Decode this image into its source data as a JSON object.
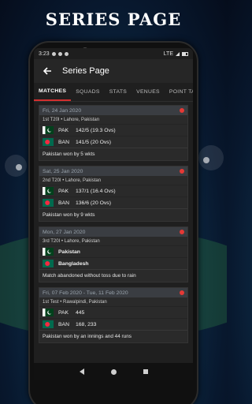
{
  "headline": "SERIES PAGE",
  "status_bar": {
    "time": "3:23",
    "network": "LTE"
  },
  "app_bar": {
    "title": "Series Page"
  },
  "tabs": [
    {
      "label": "MATCHES",
      "active": true
    },
    {
      "label": "SQUADS",
      "active": false
    },
    {
      "label": "STATS",
      "active": false
    },
    {
      "label": "VENUES",
      "active": false
    },
    {
      "label": "POINT TA",
      "active": false
    }
  ],
  "matches": [
    {
      "date": "Fri, 24 Jan 2020",
      "venue": "1st T20I • Lahore, Pakistan",
      "teams": [
        {
          "code": "PAK",
          "score": "142/5 (19.3 Ovs)",
          "flag": "pakistan"
        },
        {
          "code": "BAN",
          "score": "141/5 (20 Ovs)",
          "flag": "bangladesh"
        }
      ],
      "result": "Pakistan won by 5 wkts"
    },
    {
      "date": "Sat, 25 Jan 2020",
      "venue": "2nd T20I • Lahore, Pakistan",
      "teams": [
        {
          "code": "PAK",
          "score": "137/1 (16.4 Ovs)",
          "flag": "pakistan"
        },
        {
          "code": "BAN",
          "score": "136/6 (20 Ovs)",
          "flag": "bangladesh"
        }
      ],
      "result": "Pakistan won by 9 wkts"
    },
    {
      "date": "Mon, 27 Jan 2020",
      "venue": "3rd T20I • Lahore, Pakistan",
      "teams": [
        {
          "name": "Pakistan",
          "flag": "pakistan"
        },
        {
          "name": "Bangladesh",
          "flag": "bangladesh"
        }
      ],
      "result": "Match abandoned without toss due to rain"
    },
    {
      "date": "Fri, 07 Feb 2020 - Tue, 11 Feb 2020",
      "venue": "1st Test • Rawalpindi, Pakistan",
      "teams": [
        {
          "code": "PAK",
          "score": "445",
          "flag": "pakistan"
        },
        {
          "code": "BAN",
          "score": "168, 233",
          "flag": "bangladesh"
        }
      ],
      "result": "Pakistan won by an innings and 44 runs"
    }
  ],
  "colors": {
    "accent": "#d32f2f",
    "live_dot": "#e53935",
    "pakistan_green": "#01411c",
    "bangladesh_green": "#006a4e",
    "bangladesh_red": "#f42a41"
  }
}
